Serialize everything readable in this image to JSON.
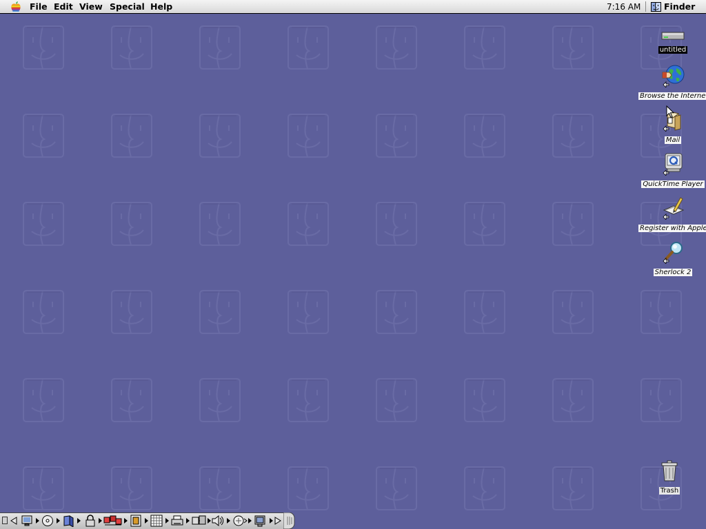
{
  "menubar": {
    "menus": [
      "File",
      "Edit",
      "View",
      "Special",
      "Help"
    ],
    "clock": "7:16 AM",
    "active_app": "Finder"
  },
  "desktop": {
    "icons": [
      {
        "label": "untitled",
        "icon": "hard-disk-icon",
        "selected": true
      },
      {
        "label": "Browse the Internet",
        "icon": "globe-alias-icon"
      },
      {
        "label": "Mail",
        "icon": "mail-alias-icon"
      },
      {
        "label": "QuickTime Player",
        "icon": "quicktime-alias-icon"
      },
      {
        "label": "Register with Apple",
        "icon": "register-alias-icon"
      },
      {
        "label": "Sherlock 2",
        "icon": "sherlock-alias-icon"
      }
    ],
    "trash": {
      "label": "Trash",
      "icon": "trash-icon"
    }
  },
  "control_strip": {
    "modules": [
      "monitor-bit-depth-icon",
      "cd-icon",
      "file-sharing-icon",
      "lock-icon",
      "appletalk-icon",
      "keychain-icon",
      "resolution-icon",
      "printer-icon",
      "remote-access-icon",
      "volume-icon",
      "speech-icon",
      "location-icon"
    ]
  },
  "colors": {
    "desktop": "#5d5f9b",
    "menubar": "#e0e0e0"
  }
}
